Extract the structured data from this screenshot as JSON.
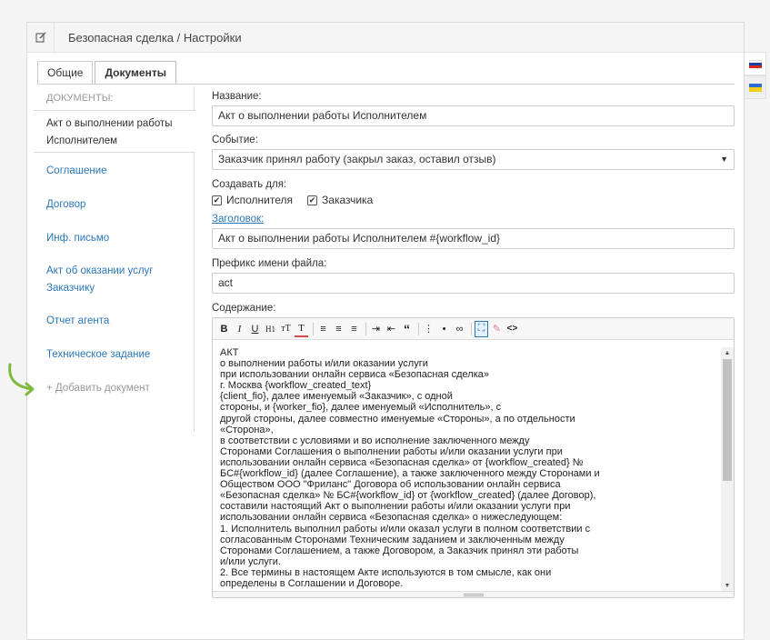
{
  "header": {
    "title": "Безопасная сделка / Настройки"
  },
  "tabs": [
    {
      "label": "Общие",
      "active": false
    },
    {
      "label": "Документы",
      "active": true
    }
  ],
  "sidebar": {
    "header": "ДОКУМЕНТЫ:",
    "items": [
      {
        "label": "Акт о выполнении работы Исполнителем",
        "active": true
      },
      {
        "label": "Соглашение",
        "active": false
      },
      {
        "label": "Договор",
        "active": false
      },
      {
        "label": "Инф. письмо",
        "active": false
      },
      {
        "label": "Акт об оказании услуг Заказчику",
        "active": false
      },
      {
        "label": "Отчет агента",
        "active": false
      },
      {
        "label": "Техническое задание",
        "active": false
      }
    ],
    "add_label": "+ Добавить документ"
  },
  "form": {
    "name_label": "Название:",
    "name_value": "Акт о выполнении работы Исполнителем",
    "event_label": "Событие:",
    "event_value": "Заказчик принял работу (закрыл заказ, оставил отзыв)",
    "create_for_label": "Создавать для:",
    "create_for": [
      {
        "label": "Исполнителя",
        "checked": true
      },
      {
        "label": "Заказчика",
        "checked": true
      }
    ],
    "header_label": "Заголовок:",
    "header_value": "Акт о выполнении работы Исполнителем #{workflow_id}",
    "prefix_label": "Префикс имени файла:",
    "prefix_value": "act",
    "content_label": "Содержание:",
    "content_text": "АКТ\nо выполнении работы и/или оказании услуги\nпри использовании онлайн сервиса «Безопасная сделка»\nг. Москва {workflow_created_text}\n{client_fio}, далее именуемый «Заказчик», с одной\nстороны, и {worker_fio}, далее именуемый «Исполнитель», с\nдругой стороны, далее совместно именуемые «Стороны», а по отдельности\n«Сторона»,\nв соответствии с условиями и во исполнение заключенного между\nСторонами Соглашения о выполнении работы и/или оказании услуги при\nиспользовании онлайн сервиса «Безопасная сделка» от {workflow_created} №\nБС#{workflow_id} (далее Соглашение), а также заключенного между Сторонами и\nОбществом ООО \"Фриланс\" Договора об использовании онлайн сервиса\n«Безопасная сделка» № БС#{workflow_id} от {workflow_created} (далее Договор),\nсоставили настоящий Акт о выполнении работы и/или оказании услуги при\nиспользовании онлайн сервиса «Безопасная сделка» о нижеследующем:\n1. Исполнитель выполнил работы и/или оказал услуги в полном соответствии с\nсогласованным Сторонами Техническим заданием и заключенным между\nСторонами Соглашением, а также Договором, а Заказчик принял эти работы\nи/или услуги.\n2. Все термины в настоящем Акте используются в том смысле, как они\nопределены в Соглашении и Договоре."
  },
  "toolbar": [
    {
      "icon": "bold-icon",
      "glyph": "B"
    },
    {
      "icon": "italic-icon",
      "glyph": "I"
    },
    {
      "icon": "underline-icon",
      "glyph": "U"
    },
    {
      "icon": "heading-icon",
      "glyph": "H1"
    },
    {
      "icon": "font-size-icon",
      "glyph": "тT"
    },
    {
      "icon": "text-color-icon",
      "glyph": "T"
    },
    {
      "icon": "align-left-icon",
      "glyph": "≡"
    },
    {
      "icon": "align-center-icon",
      "glyph": "≡"
    },
    {
      "icon": "align-right-icon",
      "glyph": "≡"
    },
    {
      "icon": "indent-icon",
      "glyph": "⇥"
    },
    {
      "icon": "outdent-icon",
      "glyph": "⇤"
    },
    {
      "icon": "quote-icon",
      "glyph": "“"
    },
    {
      "icon": "ordered-list-icon",
      "glyph": "⋮"
    },
    {
      "icon": "bullet-list-icon",
      "glyph": "•"
    },
    {
      "icon": "link-icon",
      "glyph": "∞"
    },
    {
      "icon": "fullscreen-icon",
      "glyph": "⛶"
    },
    {
      "icon": "eraser-icon",
      "glyph": "✎"
    },
    {
      "icon": "code-icon",
      "glyph": "<>"
    }
  ],
  "colors": {
    "link": "#2a77b8",
    "arrow": "#7dba3c",
    "flag_ru": [
      "#ffffff",
      "#1c3fa8",
      "#d52b1e"
    ],
    "flag_ua": [
      "#2f6ed0",
      "#f2cf1a"
    ]
  }
}
